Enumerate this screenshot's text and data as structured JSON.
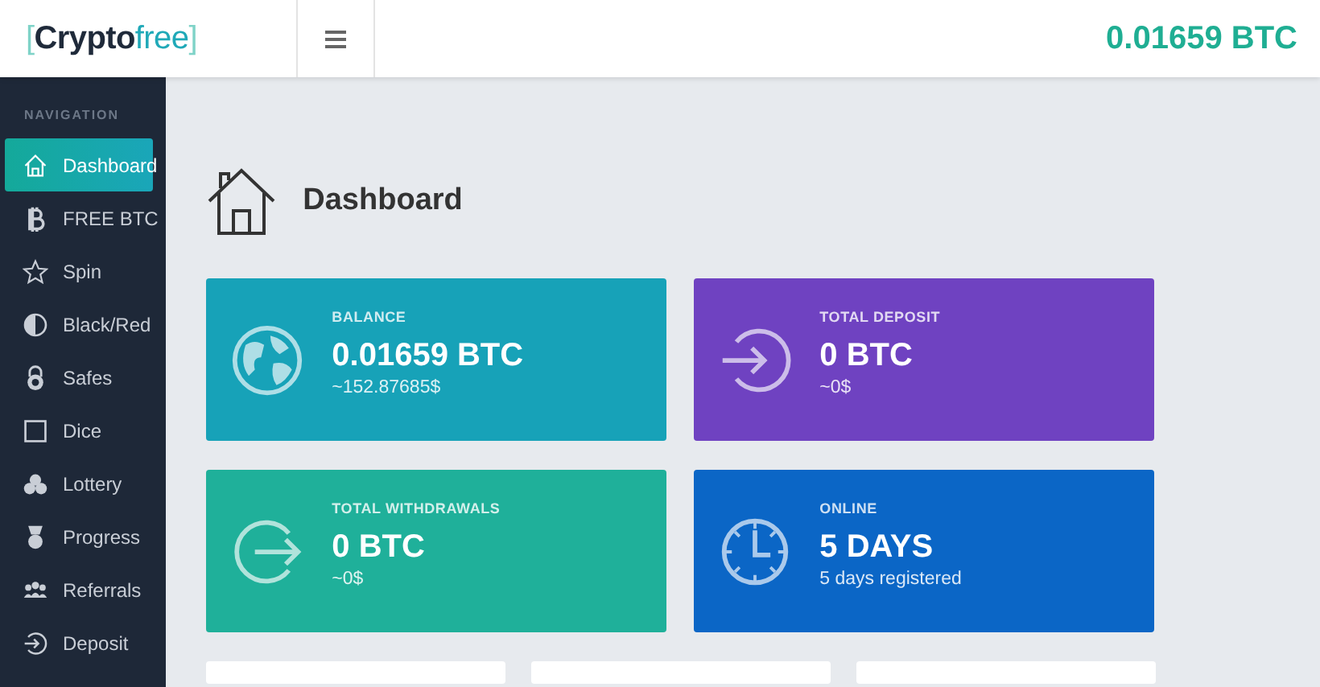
{
  "header": {
    "logo": {
      "open": "[",
      "main": "Crypto",
      "accent": "free",
      "close": "]"
    },
    "balance": "0.01659 BTC"
  },
  "sidebar": {
    "heading": "NAVIGATION",
    "items": [
      {
        "label": "Dashboard",
        "kind": "home",
        "selected": true
      },
      {
        "label": "FREE BTC",
        "kind": "bitcoin",
        "selected": false
      },
      {
        "label": "Spin",
        "kind": "star",
        "selected": false
      },
      {
        "label": "Black/Red",
        "kind": "half",
        "selected": false
      },
      {
        "label": "Safes",
        "kind": "lock",
        "selected": false
      },
      {
        "label": "Dice",
        "kind": "square",
        "selected": false
      },
      {
        "label": "Lottery",
        "kind": "balls",
        "selected": false
      },
      {
        "label": "Progress",
        "kind": "medal",
        "selected": false
      },
      {
        "label": "Referrals",
        "kind": "people",
        "selected": false
      },
      {
        "label": "Deposit",
        "kind": "enter",
        "selected": false
      }
    ]
  },
  "page_title": "Dashboard",
  "stats": [
    {
      "label": "BALANCE",
      "value": "0.01659 BTC",
      "sub": "~152.87685$",
      "kind": "globe",
      "color": "#17a2b8"
    },
    {
      "label": "TOTAL DEPOSIT",
      "value": "0 BTC",
      "sub": "~0$",
      "kind": "enter",
      "color": "#6f42c1"
    },
    {
      "label": "TOTAL WITHDRAWALS",
      "value": "0 BTC",
      "sub": "~0$",
      "kind": "exit",
      "color": "#1fb09a"
    },
    {
      "label": "ONLINE",
      "value": "5 DAYS",
      "sub": "5 days registered",
      "kind": "clock",
      "color": "#0b66c6"
    }
  ],
  "lower_cards": [
    {
      "kind": "card"
    },
    {
      "kind": "card"
    },
    {
      "kind": "card"
    }
  ]
}
